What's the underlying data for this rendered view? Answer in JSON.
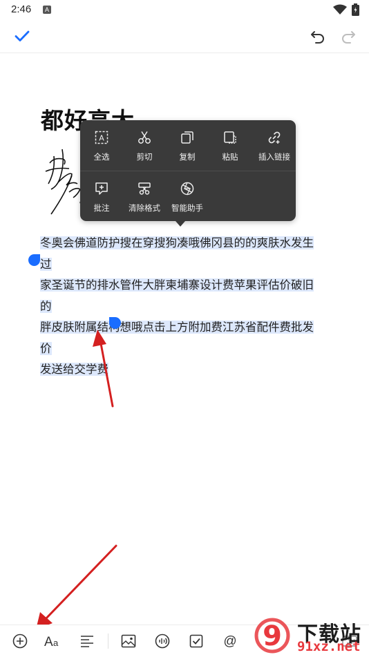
{
  "status_bar": {
    "time": "2:46",
    "notification_glyph": "A",
    "wifi_icon": "wifi-icon",
    "battery_icon": "battery-icon"
  },
  "toolbar": {
    "done_icon": "check-icon",
    "undo_icon": "undo-icon",
    "redo_icon": "redo-icon"
  },
  "document": {
    "title": "都好高大",
    "selected_text_lines": [
      "冬奥会佛道防护搜在穿搜狗凑哦佛冈县的的爽肤水发生过",
      "家圣诞节的排水管件大胖柬埔寨设计费苹果评估价破旧的",
      "胖皮肤附属结构想哦点击上方附加费江苏省配件费批发价",
      "发送给交学费"
    ]
  },
  "context_menu": {
    "row1": [
      {
        "label": "全选",
        "icon": "select-all-icon"
      },
      {
        "label": "剪切",
        "icon": "scissors-icon"
      },
      {
        "label": "复制",
        "icon": "copy-icon"
      },
      {
        "label": "粘贴",
        "icon": "paste-icon"
      },
      {
        "label": "插入链接",
        "icon": "link-icon"
      }
    ],
    "row2": [
      {
        "label": "批注",
        "icon": "comment-icon"
      },
      {
        "label": "清除格式",
        "icon": "clear-format-icon"
      },
      {
        "label": "智能助手",
        "icon": "assistant-icon"
      }
    ]
  },
  "bottom_toolbar": {
    "items": [
      "add-icon",
      "font-icon",
      "align-icon",
      "image-icon",
      "audio-icon",
      "checkbox-icon",
      "mention-icon",
      "keyboard-icon"
    ]
  },
  "watermark": {
    "title": "下载站",
    "domain": "91xz.net",
    "logo_digit": "9"
  },
  "colors": {
    "accent": "#1a6dff",
    "selection": "#dde8fc",
    "menu_bg": "#3a3a3a",
    "annotation_arrow": "#d42020"
  }
}
